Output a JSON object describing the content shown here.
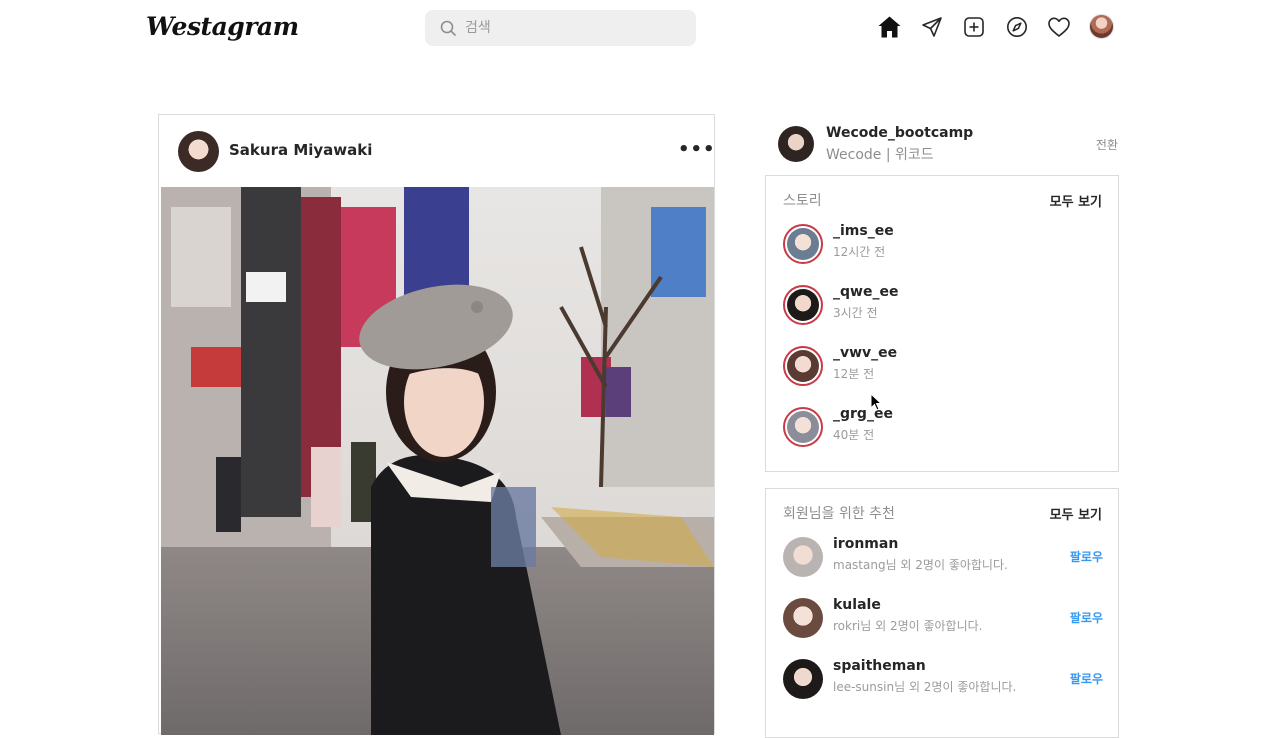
{
  "header": {
    "logo": "Westagram",
    "search_placeholder": "검색"
  },
  "icons": {
    "home": "home-icon",
    "direct": "paper-plane-icon",
    "new_post": "plus-square-icon",
    "explore": "compass-icon",
    "activity": "heart-icon"
  },
  "feed": {
    "username": "Sakura Miyawaki",
    "more": "•••"
  },
  "me": {
    "username": "Wecode_bootcamp",
    "subtitle": "Wecode | 위코드",
    "switch_label": "전환"
  },
  "stories": {
    "title": "스토리",
    "see_all": "모두 보기",
    "items": [
      {
        "name": "_ims_ee",
        "time": "12시간 전"
      },
      {
        "name": "_qwe_ee",
        "time": "3시간 전"
      },
      {
        "name": "_vwv_ee",
        "time": "12분 전"
      },
      {
        "name": "_grg_ee",
        "time": "40분 전"
      }
    ]
  },
  "suggestions": {
    "title": "회원님을 위한 추천",
    "see_all": "모두 보기",
    "items": [
      {
        "name": "ironman",
        "sub": "mastang님 외 2명이 좋아합니다.",
        "action": "팔로우"
      },
      {
        "name": "kulale",
        "sub": "rokri님 외 2명이 좋아합니다.",
        "action": "팔로우"
      },
      {
        "name": "spaitheman",
        "sub": "lee-sunsin님 외 2명이 좋아합니다.",
        "action": "팔로우"
      }
    ]
  },
  "colors": {
    "story_ring": "#c93a47",
    "follow": "#3897f0",
    "border": "#dbdbdb"
  }
}
